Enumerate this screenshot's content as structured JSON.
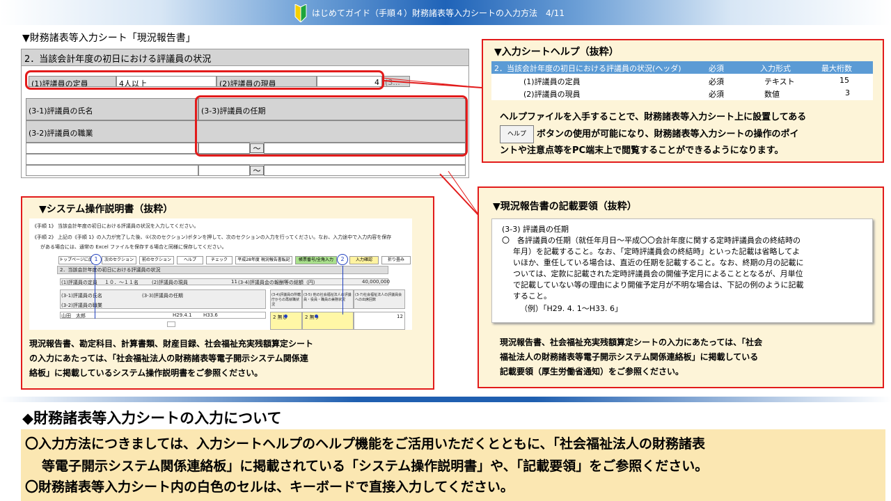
{
  "header": {
    "title": "はじめてガイド（手順４）財務諸表等入力シートの入力方法　4/11"
  },
  "sheet_caption": "▼財務諸表等入力シート「現況報告書」",
  "sheet": {
    "section_title": "2．当該会計年度の初日における評議員の状況",
    "row1": {
      "label1": "(1)評議員の定員",
      "value1": "4人以上",
      "label2": "(2)評議員の現員",
      "value2": "4",
      "cut": "(3..."
    },
    "name_label": "(3-1)評議員の氏名",
    "term_label": "(3-3)評議員の任期",
    "job_label": "(3-2)評議員の職業",
    "tilde": "～"
  },
  "help_panel": {
    "title": "▼入力シートヘルプ（抜粋）",
    "table_head": {
      "item": "2．当該会計年度の初日における評議員の状況(ヘッダ)",
      "req": "必須",
      "type": "入力形式",
      "max": "最大桁数"
    },
    "rows": [
      {
        "item": "(1)評議員の定員",
        "req": "必須",
        "type": "テキスト",
        "max": "15"
      },
      {
        "item": "(2)評議員の現員",
        "req": "必須",
        "type": "数値",
        "max": "3"
      }
    ],
    "text1": "ヘルプファイルを入手することで、財務諸表等入力シート上に設置してある",
    "button": "ヘルプ",
    "text2": "ボタンの使用が可能になり、財務諸表等入力シートの操作のポイ",
    "text3": "ントや注意点等をPC端末上で閲覧することができるようになります。"
  },
  "kisai_panel": {
    "title": "▼現況報告書の記載要領（抜粋）",
    "lines": [
      "(3-3) 評議員の任期",
      "〇　各評議員の任期（就任年月日～平成〇〇会計年度に関する定時評議員会の終結時の",
      "年月）を記載すること。なお、「定時評議員会の終結時」といった記載は省略してよ",
      "いほか、重任している場合は、直近の任期を記載すること。なお、終期の月の記載に",
      "ついては、定款に記載された定時評議員会の開催予定月によることとなるが、月単位",
      "で記載していない等の理由により開催予定月が不明な場合は、下記の例のように記載",
      "すること。",
      "（例）「H29. 4. 1～H33. 6」"
    ],
    "foot": [
      "現況報告書、社会福祉充実残額算定シートの入力にあたっては、「社会",
      "福祉法人の財務諸表等電子開示システム関係連絡板」に掲載している",
      "記載要領（厚生労働省通知）をご参照ください。"
    ]
  },
  "system_panel": {
    "title": "▼システム操作説明書（抜粋）",
    "mini": {
      "step1": "《手順 1》 当該会計年度の初日における評議員の状況を入力してください。",
      "step2": "《手順 2》 上記の《手順 1》の入力が完了した後、①(次のセクション)ボタンを押して、次のセクションの入力を行ってください。なお、入力途中で入力内容を保存",
      "step2b": "がある場合には、通常の Excel ファイルを保存する場合と同様に保存してください。",
      "buttons": [
        "トップページに戻る",
        "次のセクション",
        "前のセクション",
        "ヘルプ",
        "チェック",
        "平成28年度 現況報告書転記",
        "帳票番号/全角入力",
        "入力確認",
        "折り畳み"
      ],
      "section": "2．当該会計年度の初日における評議員の状況",
      "r1a": "(1)評議員の定員",
      "r1b": "１０．～１１名",
      "r1c": "(2)評議員の現員",
      "r1d": "11",
      "r1e": "(3-4)評議員会の報酬等の総額（円）",
      "r1f": "40,000,000",
      "h1": "(3-1)評議員の氏名",
      "h2": "(3-3)評議員の任期",
      "h3": "(3-4)評議員の所轄庁からの再就職状況",
      "h4": "(3-5) 他の社会福祉法人の評議員・役員・職員の兼務状況",
      "h5": "(3-7)社会福祉法人の評議員会への出席回数",
      "h6": "(3-2)評議員の職業",
      "d1": "山田　太郎",
      "d2": "H29.4.1",
      "d3": "H33.6",
      "d4": "2 無し",
      "d5": "2 無り",
      "d6": "12",
      "circle1": "1",
      "circle2": "2"
    },
    "foot": [
      "現況報告書、勘定科目、計算書類、財産目録、社会福祉充実残額算定シート",
      "の入力にあたっては、「社会福祉法人の財務諸表等電子開示システム関係連",
      "絡板」に掲載しているシステム操作説明書をご参照ください。"
    ]
  },
  "bottom": {
    "heading": "◆財務諸表等入力シートの入力について",
    "lines": [
      "〇入力方法につきましては、入力シートヘルプのヘルプ機能をご活用いただくとともに、「社会福祉法人の財務諸表",
      "等電子開示システム関係連絡板」に掲載されている「システム操作説明書」や、「記載要領」をご参照ください。",
      "〇財務諸表等入力シート内の白色のセルは、キーボードで直接入力してください。"
    ]
  }
}
